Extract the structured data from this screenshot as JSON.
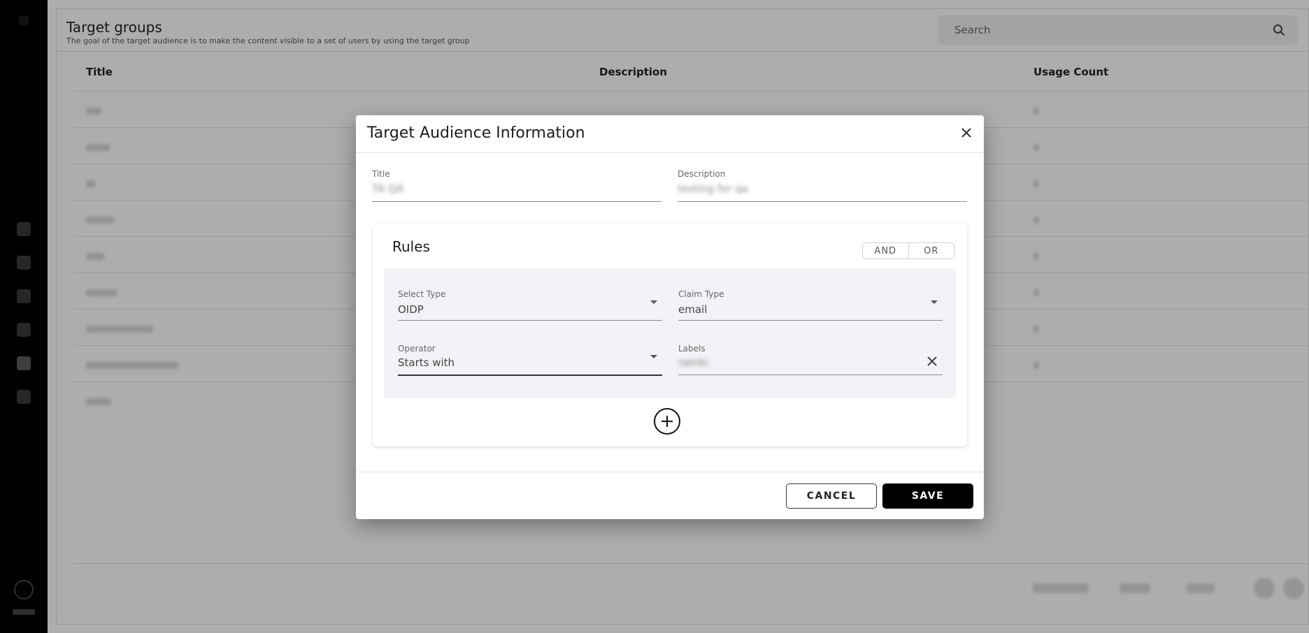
{
  "page": {
    "title": "Target groups",
    "subtitle": "The goal of the target audience is to make the content visible to a set of users by using the target group"
  },
  "search": {
    "placeholder": "Search"
  },
  "table": {
    "columns": [
      "Title",
      "Description",
      "Usage Count"
    ]
  },
  "modal": {
    "title": "Target Audience Information",
    "title_field": {
      "label": "Title",
      "value": "TA QA"
    },
    "description_field": {
      "label": "Description",
      "value": "testing for qa"
    },
    "rules": {
      "heading": "Rules",
      "logic_options": [
        "AND",
        "OR"
      ],
      "rule": {
        "select_type": {
          "label": "Select Type",
          "value": "OIDP"
        },
        "claim_type": {
          "label": "Claim Type",
          "value": "email"
        },
        "operator": {
          "label": "Operator",
          "value": "Starts with"
        },
        "labels": {
          "label": "Labels",
          "value": "ramki"
        }
      }
    },
    "cancel_label": "CANCEL",
    "save_label": "SAVE"
  }
}
